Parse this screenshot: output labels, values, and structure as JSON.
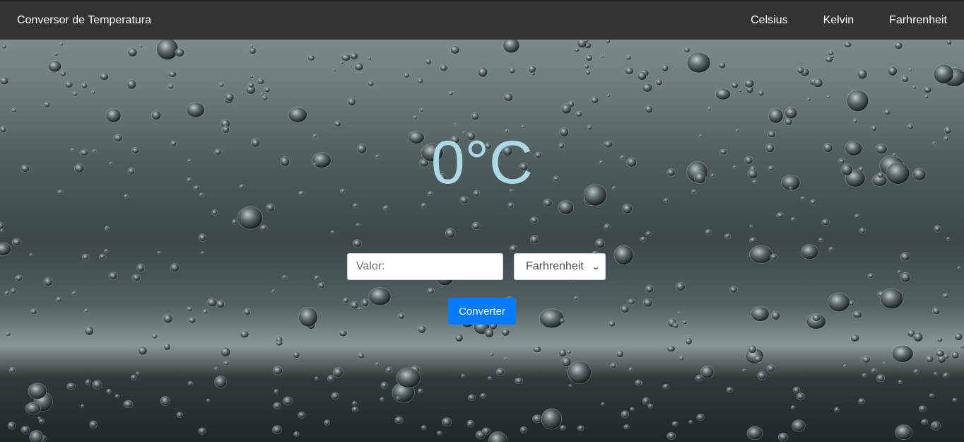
{
  "navbar": {
    "brand": "Conversor de Temperatura",
    "links": [
      {
        "label": "Celsius"
      },
      {
        "label": "Kelvin"
      },
      {
        "label": "Farhrenheit"
      }
    ]
  },
  "main": {
    "temperature_display": "0°C",
    "value_input": {
      "placeholder": "Valor:",
      "value": ""
    },
    "unit_select": {
      "selected": "Farhrenheit"
    },
    "convert_button_label": "Converter"
  },
  "colors": {
    "navbar_bg": "#333333",
    "temperature_text": "#add8e6",
    "button_bg": "#007bff"
  },
  "icons": {
    "select_arrow": "chevron-down-icon"
  }
}
